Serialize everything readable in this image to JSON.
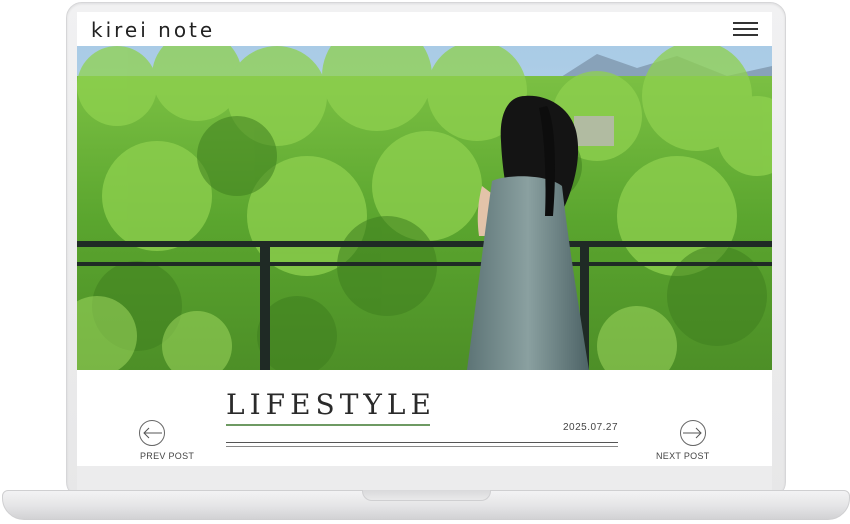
{
  "site": {
    "brand": "kirei note",
    "menu_icon": "hamburger-menu-icon"
  },
  "hero": {
    "description_icon": "photo"
  },
  "post": {
    "category": "LIFESTYLE",
    "date": "2025.07.27"
  },
  "nav": {
    "prev_label": "PREV POST",
    "next_label": "NEXT POST",
    "prev_icon": "arrow-left-circle-icon",
    "next_icon": "arrow-right-circle-icon"
  },
  "colors": {
    "accent": "#6e9a63",
    "text": "#2a2a2a"
  }
}
